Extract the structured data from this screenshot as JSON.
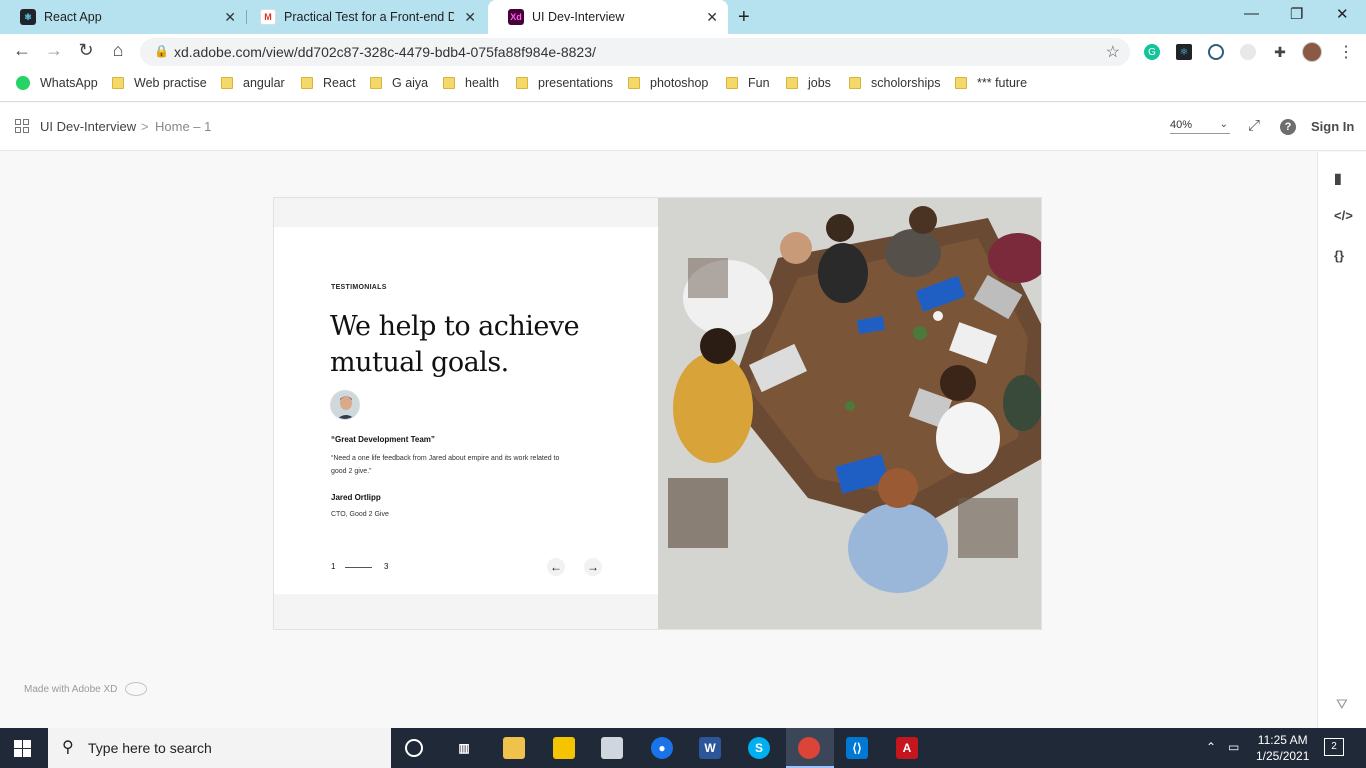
{
  "browser": {
    "tabs": [
      {
        "title": "React App",
        "favicon": "react-icon",
        "active": false
      },
      {
        "title": "Practical Test for a Front-end Dev",
        "favicon": "gmail-icon",
        "active": false
      },
      {
        "title": "UI Dev-Interview",
        "favicon": "adobe-xd-icon",
        "active": true
      }
    ],
    "url": "xd.adobe.com/view/dd702c87-328c-4479-bdb4-075fa88f984e-8823/",
    "bookmarks": [
      "WhatsApp",
      "Web practise",
      "angular",
      "React",
      "G aiya",
      "health",
      "presentations",
      "photoshop",
      "Fun",
      "jobs",
      "scholorships",
      "*** future"
    ]
  },
  "xd": {
    "project": "UI Dev-Interview",
    "separator": ">",
    "page": "Home – 1",
    "zoom": "40%",
    "signin": "Sign In",
    "made_with": "Made with Adobe XD"
  },
  "artboard": {
    "kicker": "TESTIMONIALS",
    "headline_line1": "We help to achieve",
    "headline_line2": "mutual goals.",
    "quote_title": "“Great Development Team”",
    "quote_body": "“Need a one life feedback from Jared about empire and its work related to good 2 give.”",
    "author": "Jared Ortlipp",
    "author_role": "CTO, Good 2 Give",
    "pager_current": "1",
    "pager_total": "3"
  },
  "taskbar": {
    "search_placeholder": "Type here to search",
    "time": "11:25 AM",
    "date": "1/25/2021",
    "notifications": "2"
  },
  "colors": {
    "tabstrip": "#b6e2f0",
    "taskbar": "#1f2937",
    "xd_accent": "#470137"
  }
}
